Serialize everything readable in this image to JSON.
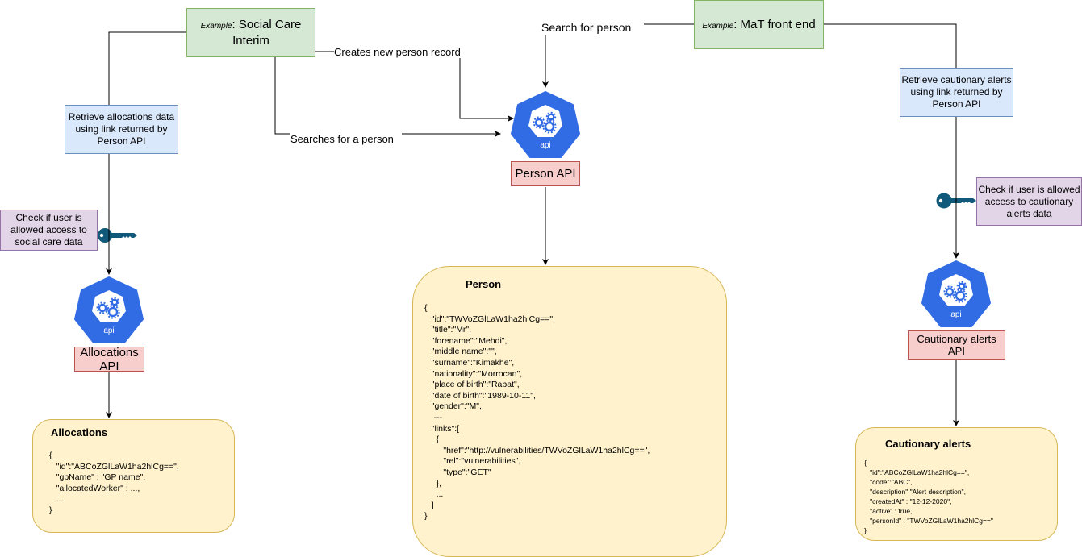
{
  "nodes": {
    "social_care": {
      "prefix": "Example",
      "suffix": ": Social Care Interim"
    },
    "mat_front_end": {
      "prefix": "Example",
      "suffix": ": MaT front end"
    },
    "retrieve_allocations": "Retrieve allocations data using link returned by Person API",
    "retrieve_cautionary": "Retrieve cautionary alerts using link returned by Person API",
    "check_social_care": "Check if user is allowed access to social care data",
    "check_cautionary": "Check if user is allowed access to cautionary alerts data",
    "person_api": "Person API",
    "allocations_api": "Allocations API",
    "cautionary_api": "Cautionary alerts API",
    "api_icon_label": "api"
  },
  "edge_labels": {
    "creates_person": "Creates new person record",
    "searches_person": "Searches for a person",
    "search_for_person": "Search for person"
  },
  "icons": {
    "key": "key-icon",
    "api": "api-gears-icon"
  },
  "cards": {
    "person": {
      "title": "Person",
      "lines": [
        "{",
        "   \"id\":\"TWVoZGlLaW1ha2hlCg==\",",
        "   \"title\":\"Mr\",",
        "   \"forename\":\"Mehdi\",",
        "   \"middle name\":\"\",",
        "   \"surname\":\"Kimakhe\",",
        "   \"nationality\":\"Morrocan\",",
        "   \"place of birth\":\"Rabat\",",
        "   \"date of birth\":\"1989-10-11\",",
        "   \"gender\":\"M\",",
        "    ---",
        "   \"links\":[",
        "     {",
        "        \"href\":\"http://vulnerabilities/TWVoZGlLaW1ha2hlCg==\",",
        "        \"rel\":\"vulnerabilities\",",
        "        \"type\":\"GET\"",
        "     },",
        "     ...",
        "   ]",
        "}"
      ]
    },
    "allocations": {
      "title": "Allocations",
      "lines": [
        "{",
        "   \"id\":\"ABCoZGlLaW1ha2hlCg==\",",
        "   \"gpName\" : \"GP name\",",
        "   \"allocatedWorker\" : ...,",
        "   ...",
        "}"
      ]
    },
    "cautionary": {
      "title": "Cautionary alerts",
      "lines": [
        "{",
        "   \"id\":\"ABCoZGlLaW1ha2hlCg==\",",
        "   \"code\":\"ABC\",",
        "   \"description\":\"Alert description\",",
        "   \"createdAt\" : \"12-12-2020\",",
        "   \"active\" : true,",
        "   \"personId\" : \"TWVoZGlLaW1ha2hlCg==\"",
        "}"
      ]
    }
  },
  "colors": {
    "green_fill": "#d5e8d4",
    "blue_fill": "#dae8fc",
    "purple_fill": "#e1d5e7",
    "red_fill": "#f8cecc",
    "yellow_fill": "#fff2cc",
    "api_blue": "#326ce5",
    "key_teal": "#10597a"
  }
}
